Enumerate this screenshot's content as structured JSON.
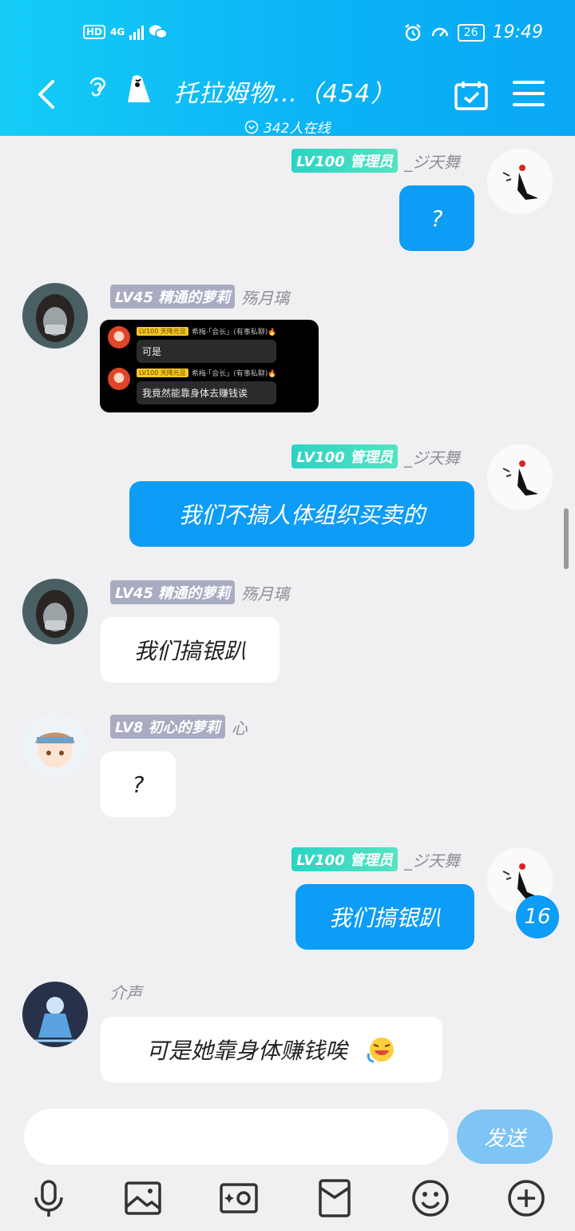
{
  "status_bar": {
    "hd": "HD",
    "network": "4G",
    "battery": "26",
    "time": "19:49"
  },
  "header": {
    "title": "托拉姆物…（454）",
    "online": "342人在线"
  },
  "messages": [
    {
      "side": "right",
      "badge": "LV100 管理员",
      "nick": "_ジ天舞",
      "text": "?"
    },
    {
      "side": "left",
      "badge": "LV45 精通的萝莉",
      "nick": "殇月璃",
      "image": {
        "rows": [
          {
            "tag": "LV100 天降元旦",
            "name": "希梅·「会长」(有事私聊)🔥",
            "text": "可是"
          },
          {
            "tag": "LV100 天降元旦",
            "name": "希梅·「会长」(有事私聊)🔥",
            "text": "我竟然能靠身体去赚钱诶"
          }
        ]
      }
    },
    {
      "side": "right",
      "badge": "LV100 管理员",
      "nick": "_ジ天舞",
      "text": "我们不搞人体组织买卖的"
    },
    {
      "side": "left",
      "badge": "LV45 精通的萝莉",
      "nick": "殇月璃",
      "text": "我们搞银趴"
    },
    {
      "side": "left",
      "badge": "LV8 初心的萝莉",
      "nick": "心",
      "text": "?"
    },
    {
      "side": "right",
      "badge": "LV100 管理员",
      "nick": "_ジ天舞",
      "text": "我们搞银趴"
    },
    {
      "side": "left",
      "nick": "介声",
      "text": "可是她靠身体赚钱唉"
    }
  ],
  "unread_count": "16",
  "composer": {
    "input_value": "",
    "send_label": "发送"
  },
  "toolbar_icons": [
    "microphone-icon",
    "image-icon",
    "camera-icon",
    "red-packet-icon",
    "emoji-icon",
    "plus-icon"
  ],
  "colors": {
    "header": "#0bb3f5",
    "bubble_blue": "#0d9cf6",
    "admin_badge": "#2ad3c4",
    "member_badge": "#a9acc1",
    "send_button": "#7ec4f4"
  }
}
